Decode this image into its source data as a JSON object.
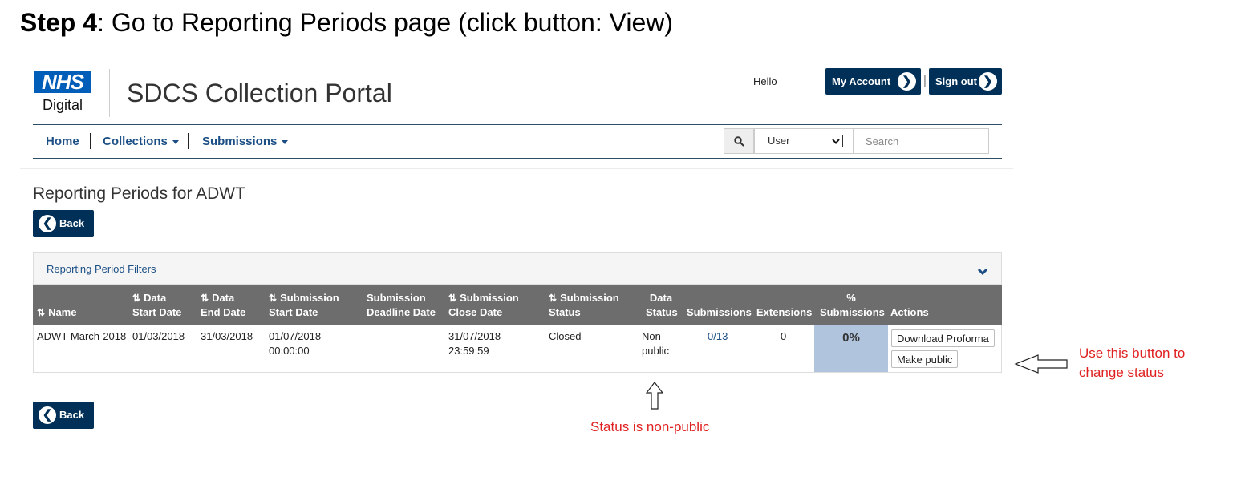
{
  "step": {
    "bold": "Step 4",
    "rest": ": Go to Reporting Periods page (click button:  View)"
  },
  "header": {
    "logo_text": "NHS",
    "logo_sub": "Digital",
    "portal_title": "SDCS Collection Portal",
    "hello": "Hello",
    "my_account": "My Account",
    "separator": "|",
    "sign_out": "Sign out"
  },
  "nav": {
    "home": "Home",
    "collections": "Collections",
    "submissions": "Submissions",
    "user_select": "User",
    "search_placeholder": "Search"
  },
  "page": {
    "heading": "Reporting Periods for ADWT",
    "back_label": "Back",
    "filters_label": "Reporting Period Filters"
  },
  "table": {
    "headers": {
      "name": "Name",
      "data_start_1": "Data",
      "data_start_2": "Start Date",
      "data_end_1": "Data",
      "data_end_2": "End Date",
      "sub_start_1": "Submission",
      "sub_start_2": "Start Date",
      "deadline_1": "Submission",
      "deadline_2": "Deadline Date",
      "close_1": "Submission",
      "close_2": "Close Date",
      "status_1": "Submission",
      "status_2": "Status",
      "data_status_1": "Data",
      "data_status_2": "Status",
      "submissions": "Submissions",
      "extensions": "Extensions",
      "pct_1": "%",
      "pct_2": "Submissions",
      "actions": "Actions"
    },
    "row": {
      "name": "ADWT-March-2018",
      "data_start": "01/03/2018",
      "data_end": "31/03/2018",
      "sub_start_date": "01/07/2018",
      "sub_start_time": "00:00:00",
      "close_date": "31/07/2018",
      "close_time": "23:59:59",
      "status": "Closed",
      "data_status_1": "Non-",
      "data_status_2": "public",
      "submissions": "0/13",
      "extensions": "0",
      "pct": "0%",
      "download_label": "Download Proforma",
      "make_public_label": "Make public"
    }
  },
  "annotations": {
    "button_note_1": "Use this button to",
    "button_note_2": "change status",
    "status_note": "Status is non-public",
    "color": "#e02020"
  },
  "colors": {
    "brand_blue": "#005eb8",
    "navy": "#003057",
    "link": "#1b4f85",
    "header_gray": "#6d6d6d",
    "pct_fill": "#b0c4de"
  }
}
